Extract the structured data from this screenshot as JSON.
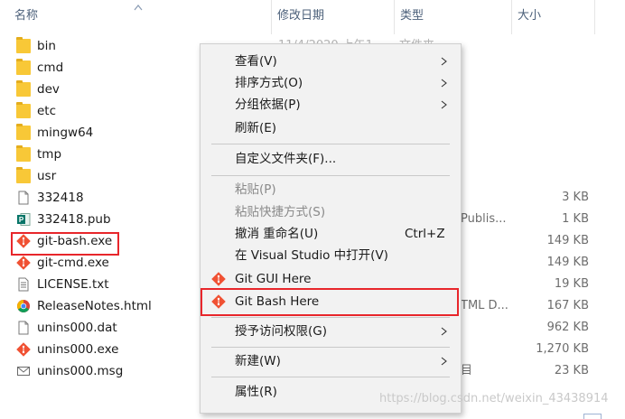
{
  "header": {
    "name": "名称",
    "date_modified": "修改日期",
    "type": "类型",
    "size": "大小"
  },
  "files": [
    {
      "name": "bin",
      "icon": "folder-icon",
      "date": "11/4/2020 上午1...",
      "type": "文件夹",
      "size": ""
    },
    {
      "name": "cmd",
      "icon": "folder-icon",
      "date": "",
      "type": "",
      "size": ""
    },
    {
      "name": "dev",
      "icon": "folder-icon",
      "date": "",
      "type": "",
      "size": ""
    },
    {
      "name": "etc",
      "icon": "folder-icon",
      "date": "",
      "type": "",
      "size": ""
    },
    {
      "name": "mingw64",
      "icon": "folder-icon",
      "date": "",
      "type": "",
      "size": ""
    },
    {
      "name": "tmp",
      "icon": "folder-icon",
      "date": "",
      "type": "",
      "size": ""
    },
    {
      "name": "usr",
      "icon": "folder-icon",
      "date": "",
      "type": "",
      "size": ""
    },
    {
      "name": "332418",
      "icon": "file-icon",
      "date": "",
      "type": "",
      "size": "3 KB"
    },
    {
      "name": "332418.pub",
      "icon": "publisher-icon",
      "date": "",
      "type": "Publis...",
      "size": "1 KB"
    },
    {
      "name": "git-bash.exe",
      "icon": "git-icon",
      "date": "",
      "type": "",
      "size": "149 KB"
    },
    {
      "name": "git-cmd.exe",
      "icon": "git-icon",
      "date": "",
      "type": "",
      "size": "149 KB"
    },
    {
      "name": "LICENSE.txt",
      "icon": "text-file-icon",
      "date": "",
      "type": "",
      "size": "19 KB"
    },
    {
      "name": "ReleaseNotes.html",
      "icon": "chrome-icon",
      "date": "",
      "type": "TML D...",
      "size": "167 KB"
    },
    {
      "name": "unins000.dat",
      "icon": "file-icon",
      "date": "",
      "type": "",
      "size": "962 KB"
    },
    {
      "name": "unins000.exe",
      "icon": "git-icon",
      "date": "",
      "type": "",
      "size": "1,270 KB"
    },
    {
      "name": "unins000.msg",
      "icon": "mail-icon",
      "date": "",
      "type": "目",
      "size": "23 KB"
    }
  ],
  "context_menu": {
    "items": [
      {
        "label": "查看(V)",
        "submenu": true
      },
      {
        "label": "排序方式(O)",
        "submenu": true
      },
      {
        "label": "分组依据(P)",
        "submenu": true
      },
      {
        "label": "刷新(E)"
      },
      {
        "label": "自定义文件夹(F)..."
      },
      {
        "label": "粘贴(P)",
        "disabled": true
      },
      {
        "label": "粘贴快捷方式(S)",
        "disabled": true
      },
      {
        "label": "撤消 重命名(U)",
        "shortcut": "Ctrl+Z"
      },
      {
        "label": "在 Visual Studio 中打开(V)"
      },
      {
        "label": "Git GUI Here",
        "icon": "git-icon"
      },
      {
        "label": "Git Bash Here",
        "icon": "git-icon"
      },
      {
        "label": "授予访问权限(G)",
        "submenu": true
      },
      {
        "label": "新建(W)",
        "submenu": true
      },
      {
        "label": "属性(R)"
      }
    ]
  },
  "watermark": "https://blog.csdn.net/weixin_43438914",
  "colors": {
    "folder": "#f8c837",
    "highlight": "#e8262b",
    "menu_bg": "#f2f2f2",
    "header_text": "#4c607a",
    "git_orange": "#f05133"
  }
}
